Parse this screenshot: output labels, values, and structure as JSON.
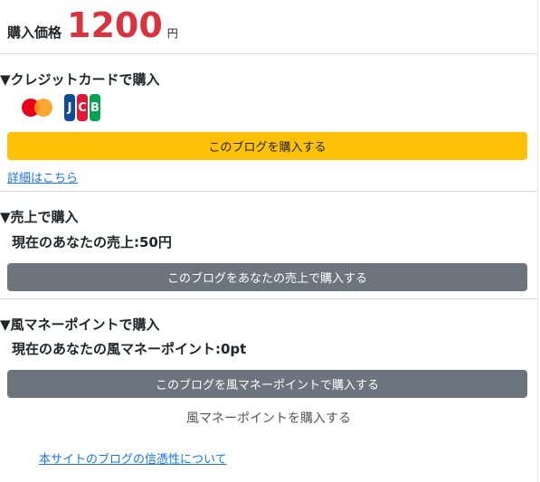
{
  "price": {
    "label": "購入価格",
    "value": "1200",
    "unit": "円"
  },
  "credit": {
    "title": "▼クレジットカードで購入",
    "card_icons": [
      "mastercard-icon",
      "jcb-icon"
    ],
    "jcb_letters": [
      "J",
      "C",
      "B"
    ],
    "button_label": "このブログを購入する",
    "details_link": "詳細はこちら"
  },
  "sales": {
    "title": "▼売上で購入",
    "balance_text": "現在のあなたの売上:50円",
    "button_label": "このブログをあなたの売上で購入する"
  },
  "points": {
    "title": "▼風マネーポイントで購入",
    "balance_text": "現在のあなたの風マネーポイント:0pt",
    "button_label": "このブログを風マネーポイントで購入する",
    "buy_points_link": "風マネーポイントを購入する"
  },
  "footer": {
    "trust_link": "本サイトのブログの信憑性について"
  },
  "colors": {
    "price": "#d9333f",
    "primary_button": "#ffc107",
    "secondary_button": "#6c757d",
    "link": "#1a73e8"
  }
}
